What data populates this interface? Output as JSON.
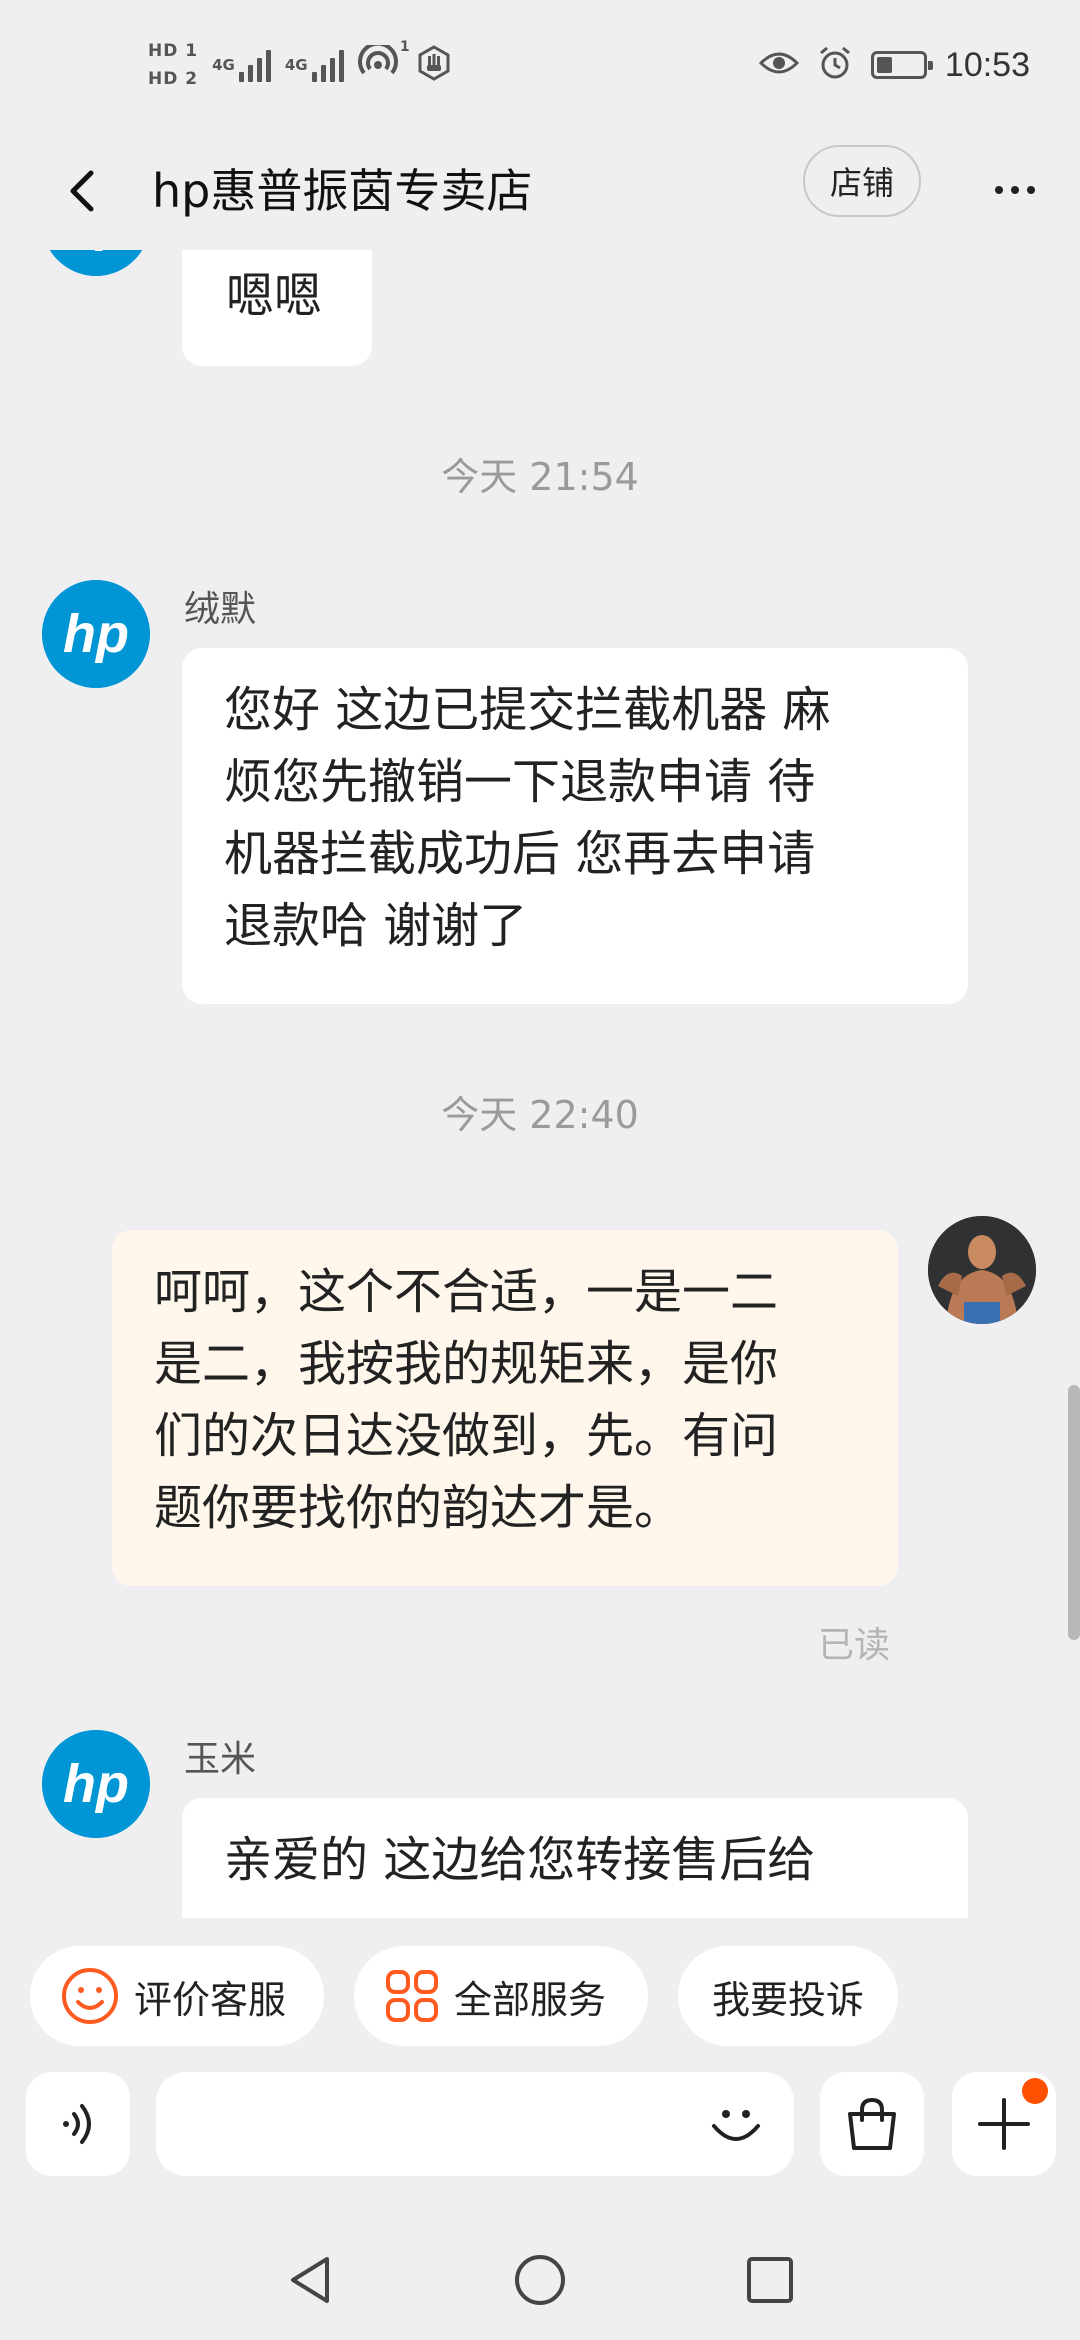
{
  "status_bar": {
    "hd1": "HD 1",
    "hd2": "HD 2",
    "network_1": "4G",
    "network_2": "4G",
    "hotspot_count": "1",
    "time": "10:53",
    "battery_level": 0.35
  },
  "header": {
    "title": "hp惠普振茵专卖店",
    "store_button": "店铺"
  },
  "messages": [
    {
      "sender": "",
      "text": "嗯嗯",
      "side": "left"
    },
    {
      "timestamp": "今天  21:54"
    },
    {
      "sender": "绒默",
      "text_lines": [
        "您好 这边已提交拦截机器 麻",
        "烦您先撤销一下退款申请  待",
        "机器拦截成功后 您再去申请",
        "退款哈 谢谢了"
      ],
      "side": "left"
    },
    {
      "timestamp": "今天  22:40"
    },
    {
      "sender": "",
      "text_lines": [
        "呵呵，这个不合适，一是一二",
        "是二，我按我的规矩来，是你",
        "们的次日达没做到，先。有问",
        "题你要找你的韵达才是。"
      ],
      "side": "right",
      "status": "已读"
    },
    {
      "sender": "玉米",
      "text_lines": [
        "亲爱的 这边给您转接售后给"
      ],
      "side": "left"
    }
  ],
  "quick_actions": [
    {
      "label": "评价客服",
      "icon": "smile-icon"
    },
    {
      "label": "全部服务",
      "icon": "grid-icon"
    },
    {
      "label": "我要投诉",
      "icon": ""
    }
  ],
  "input": {
    "placeholder": ""
  },
  "colors": {
    "background": "#efeff1",
    "hp_blue": "#0096d6",
    "my_bubble": "#fff7ec",
    "accent_orange": "#ff5000"
  }
}
